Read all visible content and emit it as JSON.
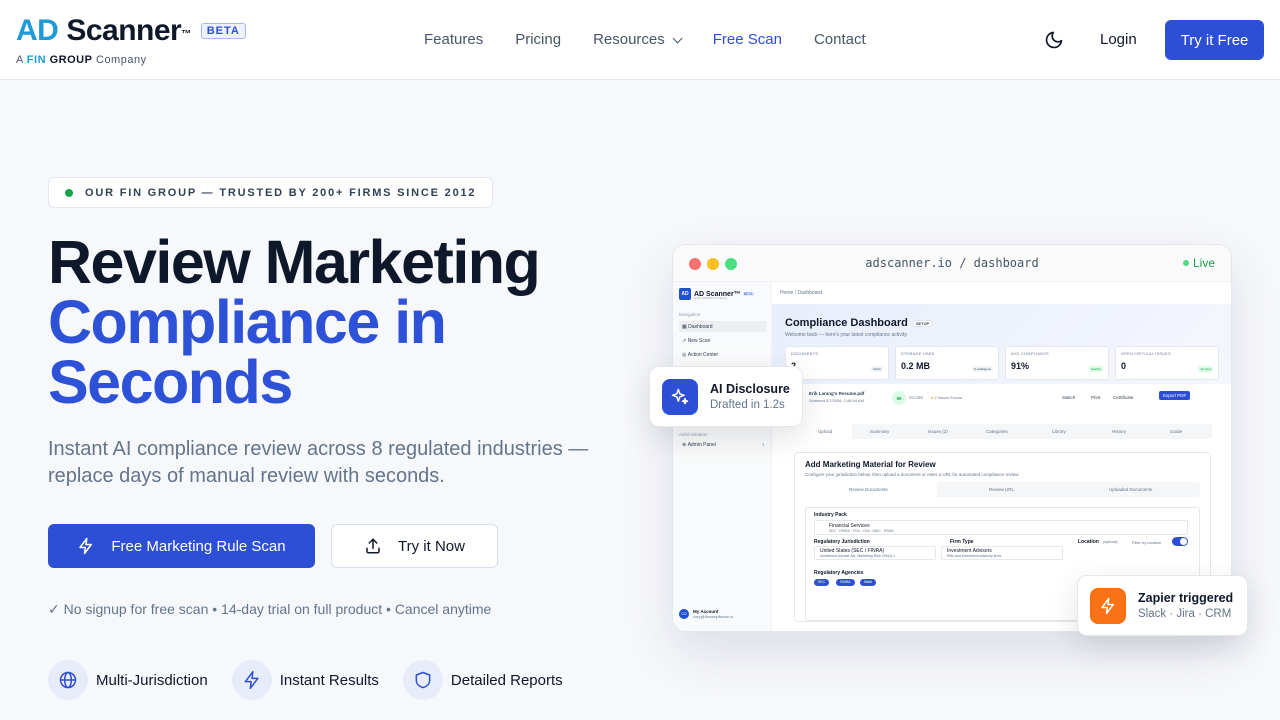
{
  "nav": {
    "logo_ad": "AD",
    "logo_scanner": "Scanner",
    "logo_tm": "™",
    "beta": "BETA",
    "sub_a": "A",
    "sub_fin": "FIN",
    "sub_group": "GROUP",
    "sub_company": "Company",
    "items": [
      "Features",
      "Pricing",
      "Resources",
      "Free Scan",
      "Contact"
    ],
    "login": "Login",
    "cta": "Try it Free",
    "theme_icon": "moon-icon"
  },
  "hero": {
    "badge": "OUR FIN GROUP — TRUSTED BY 200+ FIRMS SINCE 2012",
    "title_line1": "Review Marketing",
    "title_line2": "Compliance in",
    "title_line3": "Seconds",
    "subtitle": "Instant AI compliance review across 8 regulated industries — replace days of manual review with seconds.",
    "primary_cta": "Free Marketing Rule Scan",
    "secondary_cta": "Try it Now",
    "note": "✓ No signup for free scan • 14-day trial on full product • Cancel anytime",
    "features": [
      "Multi-Jurisdiction",
      "Instant Results",
      "Detailed Reports"
    ]
  },
  "preview": {
    "url": "adscanner.io / dashboard",
    "live": "Live",
    "sidebar": {
      "logo": "AD Scanner™",
      "beta": "BETA",
      "logo_sub": "A FIN GROUP Company",
      "section": "Navigation",
      "items": [
        "Dashboard",
        "New Scan",
        "Action Center"
      ],
      "admin_section": "Administration",
      "admin_item": "Admin Panel",
      "account_name": "My Account",
      "account_email": "cory@fincompliance.io",
      "avatar": "CO"
    },
    "breadcrumb": "Home  /  Dashboard",
    "dash_title": "Compliance Dashboard",
    "setup": "SETUP",
    "dash_sub": "Welcome back — here's your latest compliance activity.",
    "stats": [
      {
        "label": "DOCUMENTS",
        "value": "2",
        "tag": "Active"
      },
      {
        "label": "STORAGE USED",
        "value": "0.2 MB",
        "tag": "In analogous"
      },
      {
        "label": "AVG COMPLIANCE",
        "value": "91%",
        "tag": "Healthy"
      },
      {
        "label": "OPEN CRITICAL ISSUES",
        "value": "0",
        "tag": "All clear"
      }
    ],
    "file_name": "Erik Larang's Resume.pdf",
    "file_scanned": "Scanned 2/7/2026, 1:46:54 AM",
    "score": "90",
    "score_label": "SCORE",
    "issues": "2 Issues Found",
    "actions": [
      "Switch",
      "Print",
      "Certificate",
      "Export PDF"
    ],
    "tabs": [
      "Upload",
      "Summary",
      "Issues (2)",
      "Categories",
      "Library",
      "History",
      "Guide"
    ],
    "add_title": "Add Marketing Material for Review",
    "add_sub": "Configure your jurisdiction below, then upload a document or enter a URL for automated compliance review",
    "subtabs": [
      "Review Documents",
      "Review URL",
      "Uploaded Documents"
    ],
    "industry_label": "Industry Pack",
    "industry_value": "Financial Services",
    "industry_sub": "SEC · FINRA · FCA · CSA · ASIC · ESMA",
    "jur_label": "Regulatory Jurisdiction",
    "jur_value": "United States (SEC / FINRA)",
    "jur_sub": "Investment Adviser Act, Marketing Rule 206(4)-1",
    "firm_label": "Firm Type",
    "firm_value": "Investment Advisors",
    "firm_sub": "Rifts and investment advisory firms",
    "loc_label": "Location",
    "loc_opt": "(optional)",
    "loc_filter": "Filter by location",
    "agencies_label": "Regulatory Agencies",
    "agencies": [
      "SEC",
      "FINRA",
      "State"
    ]
  },
  "cards": {
    "ai_title": "AI Disclosure",
    "ai_sub": "Drafted in 1.2s",
    "zap_title": "Zapier triggered",
    "zap_sub": "Slack · Jira · CRM"
  },
  "colors": {
    "brand": "#2d4fd6",
    "accent_blue": "#1e9ad6",
    "live_green": "#16a34a",
    "orange": "#f97316"
  }
}
